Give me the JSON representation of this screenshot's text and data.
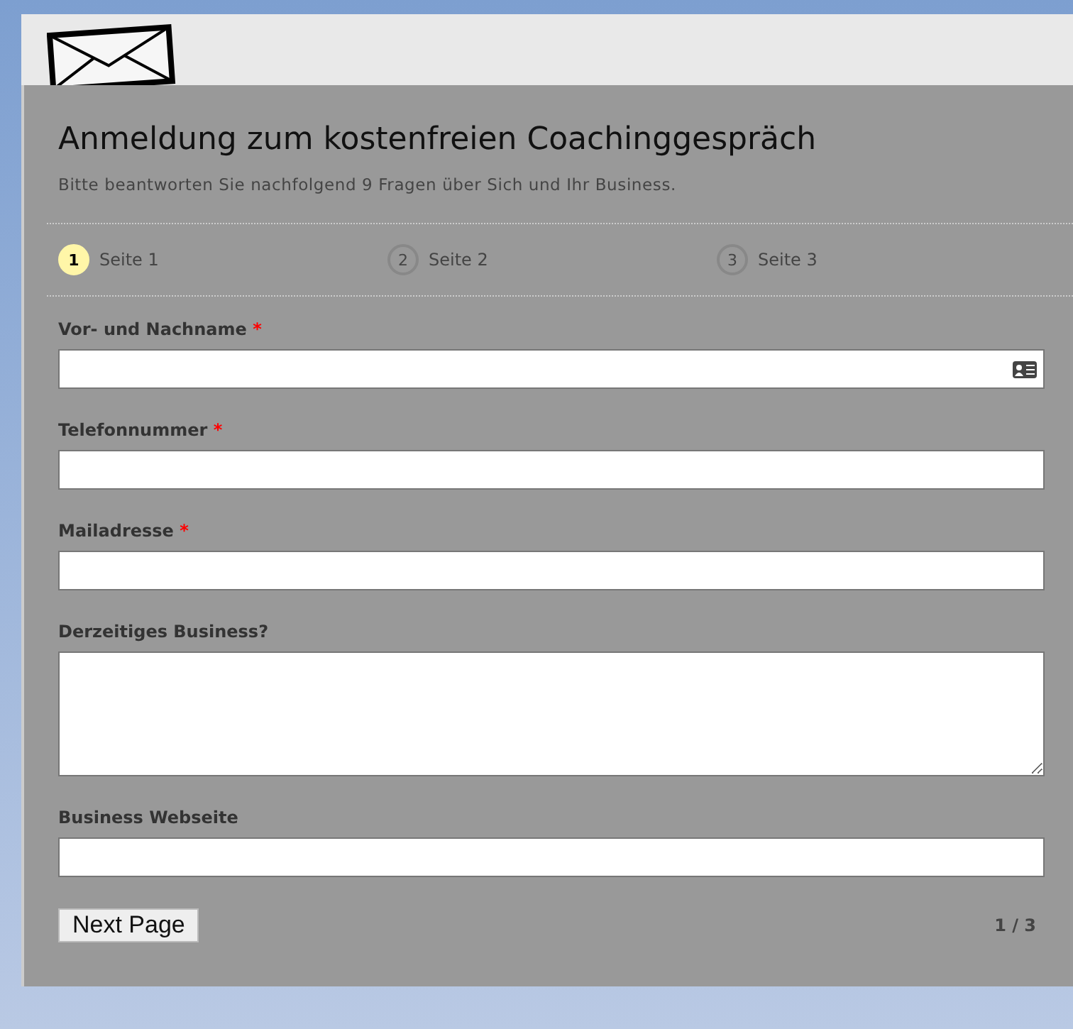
{
  "form": {
    "title": "Anmeldung zum kostenfreien Coachinggespräch",
    "subtitle": "Bitte beantworten Sie nachfolgend 9 Fragen über Sich und Ihr Business.",
    "steps": [
      {
        "number": "1",
        "label": "Seite 1",
        "selected": true
      },
      {
        "number": "2",
        "label": "Seite 2",
        "selected": false
      },
      {
        "number": "3",
        "label": "Seite 3",
        "selected": false
      }
    ],
    "fields": [
      {
        "kind": "name",
        "label": "Vor- und Nachname",
        "required_mark": "*"
      },
      {
        "kind": "text",
        "label": "Telefonnummer",
        "required_mark": "*"
      },
      {
        "kind": "text",
        "label": "Mailadresse",
        "required_mark": "*"
      },
      {
        "kind": "textarea",
        "label": "Derzeitiges Business?"
      },
      {
        "kind": "text",
        "label": "Business Webseite"
      }
    ],
    "next_button": "Next Page",
    "page_counter": "1 / 3"
  }
}
